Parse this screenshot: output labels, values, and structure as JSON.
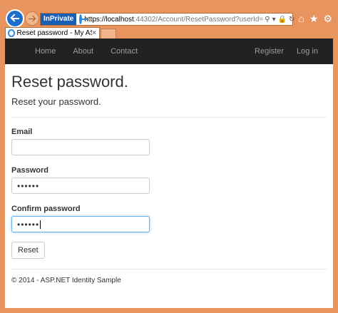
{
  "browser": {
    "inprivate_label": "InPrivate",
    "url_host": "https://localhost",
    "url_path": ":44302/Account/ResetPassword?userId=",
    "tab_title": "Reset password - My ASP.N...",
    "tab_close": "×"
  },
  "navbar": {
    "left_items": [
      "Home",
      "About",
      "Contact"
    ],
    "right_items": [
      "Register",
      "Log in"
    ]
  },
  "page": {
    "title": "Reset password.",
    "subtitle": "Reset your password."
  },
  "form": {
    "email_label": "Email",
    "email_value": "",
    "password_label": "Password",
    "password_value": "••••••",
    "confirm_label": "Confirm password",
    "confirm_value": "••••••",
    "submit_label": "Reset"
  },
  "footer": {
    "text": "© 2014 - ASP.NET Identity Sample"
  },
  "colors": {
    "navbar_bg": "#222222",
    "navbar_text": "#9d9d9d",
    "chrome_bg": "#e8945f",
    "focus_border": "#66afe9"
  }
}
